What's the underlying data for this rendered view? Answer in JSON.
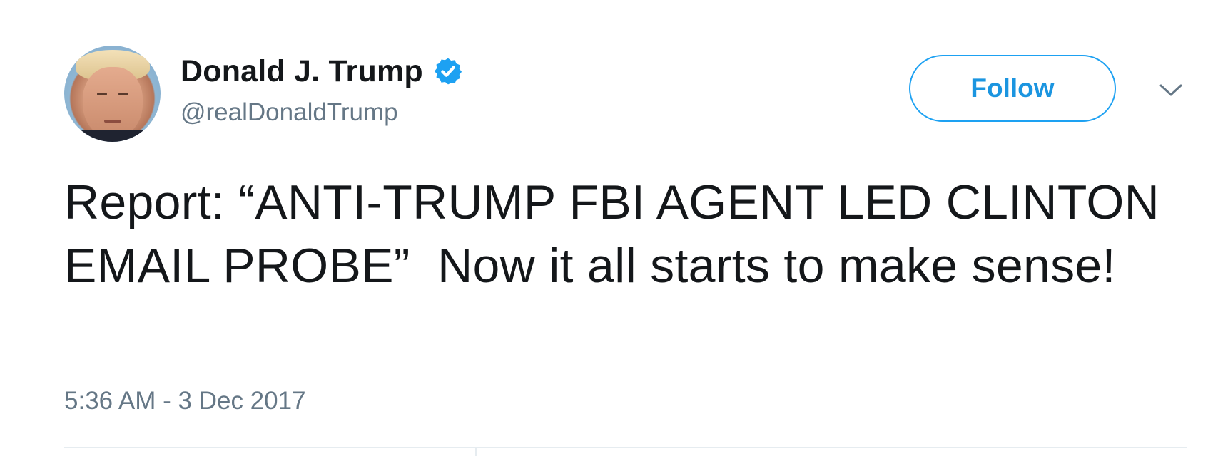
{
  "author": {
    "display_name": "Donald J. Trump",
    "handle": "@realDonaldTrump",
    "verified_icon": "verified-badge-icon",
    "avatar": "profile-photo"
  },
  "actions": {
    "follow_label": "Follow",
    "more_icon": "chevron-down-icon"
  },
  "tweet": {
    "text": "Report: “ANTI-TRUMP FBI AGENT LED CLINTON EMAIL PROBE”  Now it all starts to make sense!",
    "timestamp": "5:36 AM - 3 Dec 2017"
  },
  "colors": {
    "accent": "#1da1f2",
    "text": "#14171a",
    "secondary_text": "#657786",
    "divider": "#e6ecf0"
  }
}
